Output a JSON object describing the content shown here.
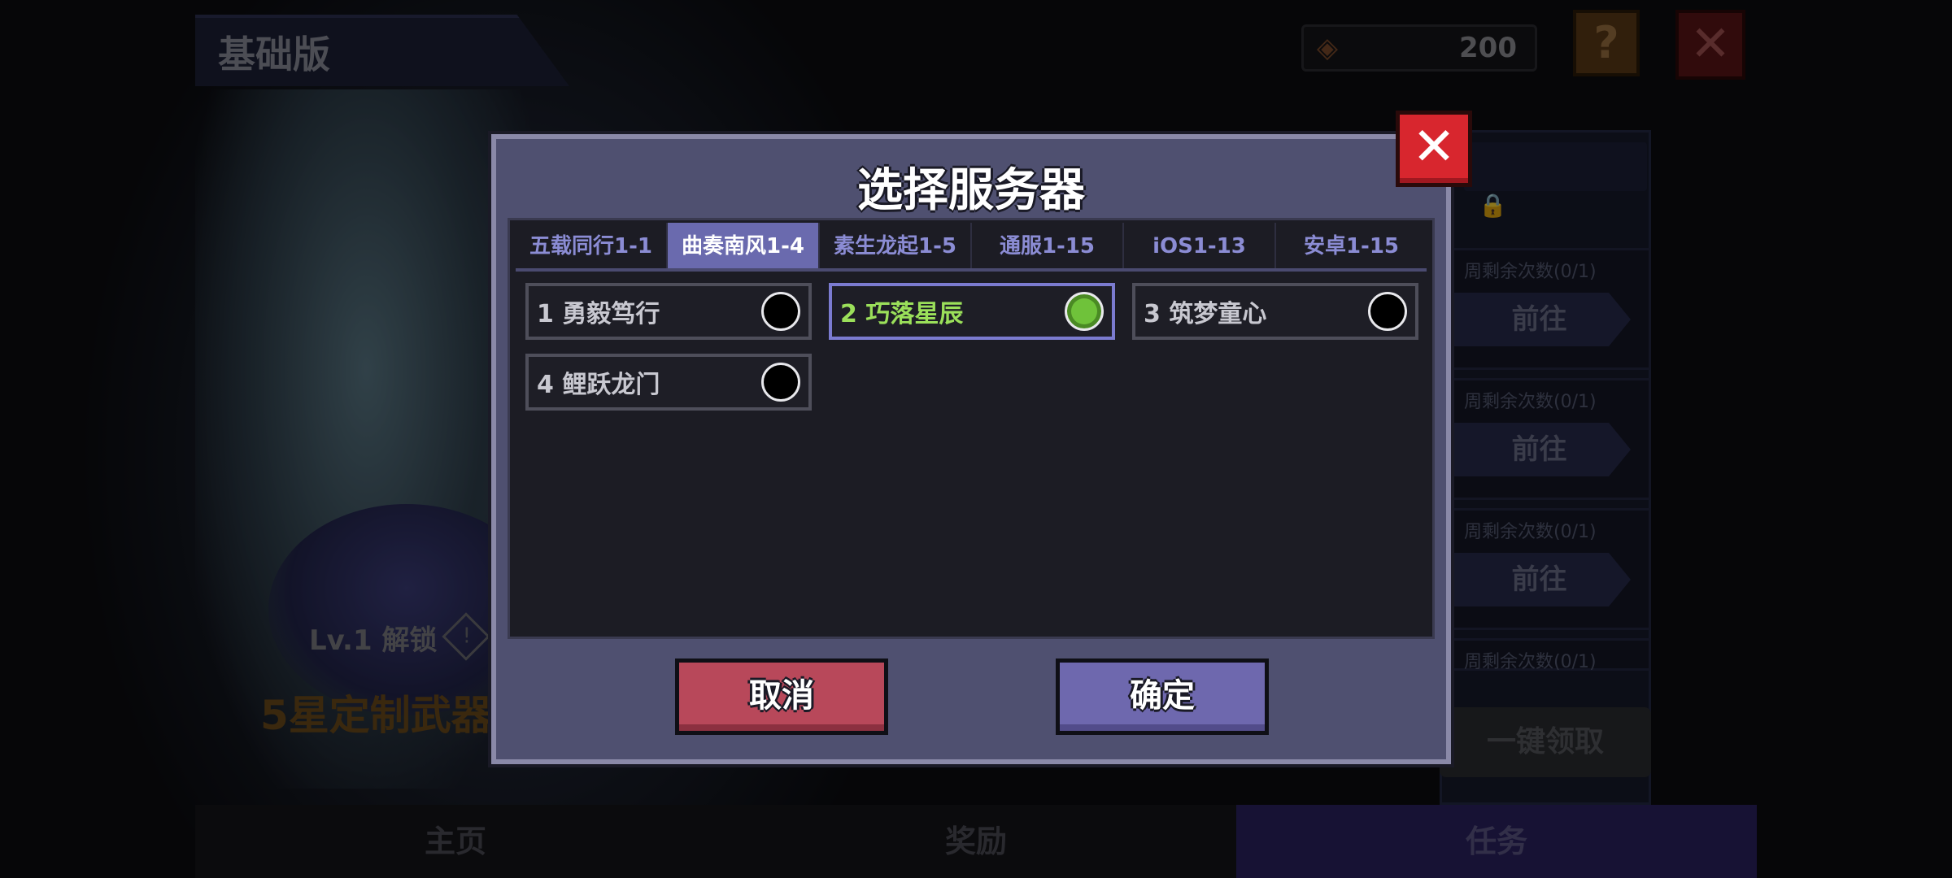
{
  "header": {
    "edition": "基础版",
    "currency_value": "200",
    "help_icon": "?",
    "close_icon": "✕"
  },
  "tasks": {
    "remaining": [
      "周剩余次数(0/1)",
      "周剩余次数(0/1)",
      "周剩余次数(0/1)",
      "周剩余次数(0/1)"
    ],
    "go_label": "前往",
    "claim_all": "一键领取"
  },
  "hero": {
    "unlock": "Lv.1 解锁",
    "unlock_icon": "!",
    "weapon": "5星定制武器"
  },
  "nav": {
    "tabs": [
      "主页",
      "奖励",
      "任务"
    ],
    "active": "任务"
  },
  "modal": {
    "title": "选择服务器",
    "close_icon": "✕",
    "tabs": [
      "五载同行1-1",
      "曲奏南风1-4",
      "素生龙起1-5",
      "通服1-15",
      "iOS1-13",
      "安卓1-15"
    ],
    "active_tab": "曲奏南风1-4",
    "servers": [
      {
        "label": "1 勇毅笃行",
        "selected": false
      },
      {
        "label": "2 巧落星辰",
        "selected": true
      },
      {
        "label": "3 筑梦童心",
        "selected": false
      },
      {
        "label": "4 鲤跃龙门",
        "selected": false
      }
    ],
    "cancel_label": "取消",
    "confirm_label": "确定"
  },
  "colors": {
    "accent_purple": "#6a6aae",
    "selected_green": "#9be05a",
    "cancel_red": "#b8485a",
    "confirm_purple": "#6e68ae",
    "close_red": "#d8262e"
  }
}
